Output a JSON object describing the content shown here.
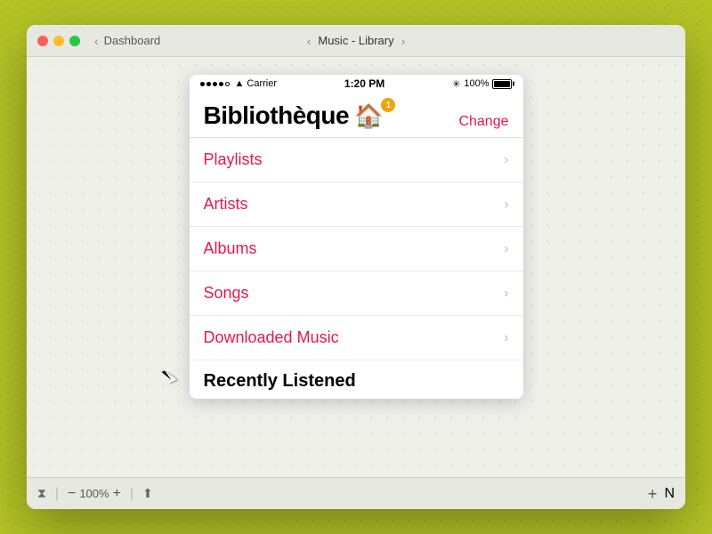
{
  "window": {
    "title": "Music - Library",
    "breadcrumb": "Dashboard"
  },
  "toolbar": {
    "zoom_level": "100%",
    "minus_label": "−",
    "plus_label": "+",
    "add_label": "+",
    "extra_label": "N"
  },
  "iphone": {
    "status_bar": {
      "carrier": "Carrier",
      "time": "1:20 PM",
      "battery_pct": "100%"
    },
    "header": {
      "title": "Bibliothèque",
      "emoji": "🏠",
      "badge": "1",
      "change_label": "Change"
    },
    "menu_items": [
      {
        "label": "Playlists",
        "id": "playlists"
      },
      {
        "label": "Artists",
        "id": "artists"
      },
      {
        "label": "Albums",
        "id": "albums"
      },
      {
        "label": "Songs",
        "id": "songs"
      },
      {
        "label": "Downloaded Music",
        "id": "downloaded-music"
      }
    ],
    "section_title": "Recently Listened"
  }
}
